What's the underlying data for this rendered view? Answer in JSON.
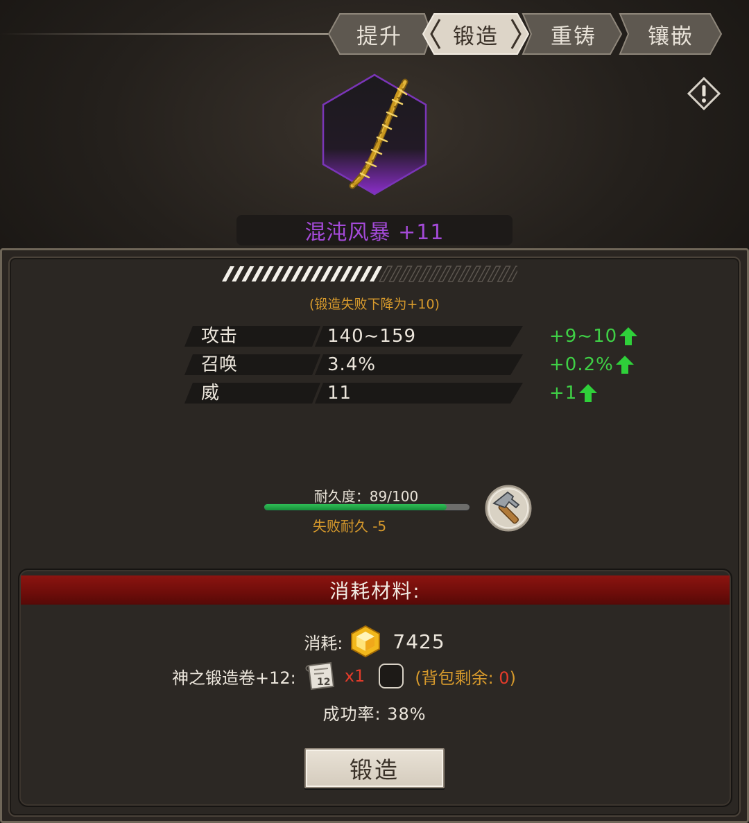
{
  "tabs": [
    {
      "label": "提升"
    },
    {
      "label": "锻造"
    },
    {
      "label": "重铸"
    },
    {
      "label": "镶嵌"
    }
  ],
  "active_tab": "锻造",
  "item": {
    "name": "混沌风暴 +11",
    "rarity_color": "#a44ad8",
    "progress_fraction": 0.52
  },
  "forge_fail_note": "(锻造失败下降为+10)",
  "stats": [
    {
      "label": "攻击",
      "value": "140~159",
      "delta": "+9~10"
    },
    {
      "label": "召唤",
      "value": "3.4%",
      "delta": "+0.2%"
    },
    {
      "label": "威",
      "value": "11",
      "delta": "+1"
    }
  ],
  "durability": {
    "label": "耐久度：89/100",
    "current": 89,
    "max": 100,
    "fail_text": "失败耐久 -5"
  },
  "materials": {
    "header": "消耗材料:",
    "cost_label": "消耗:",
    "cost_value": "7425",
    "scroll_label": "神之锻造卷+12:",
    "scroll_count": "x1",
    "bag_prefix": "(背包剩余: ",
    "bag_count": "0",
    "bag_suffix": ")",
    "success_rate": "成功率: 38%"
  },
  "forge_button": "锻造",
  "colors": {
    "green_delta": "#3fd046",
    "orange_note": "#d79a2c",
    "red_count": "#e43b2a",
    "header_red": "#7a0f0b"
  }
}
